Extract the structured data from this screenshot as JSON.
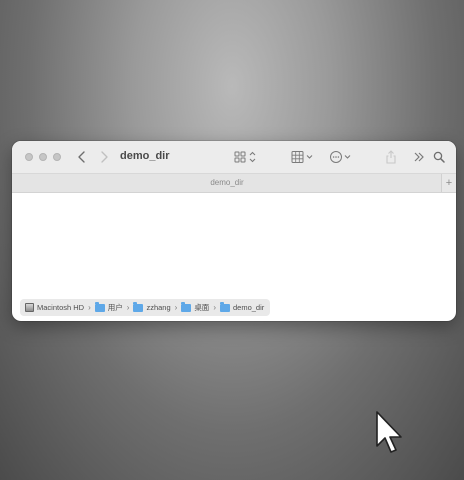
{
  "window": {
    "title": "demo_dir",
    "tab_label": "demo_dir",
    "tab_add_label": "+"
  },
  "toolbar": {
    "icons": [
      "back-icon",
      "forward-icon",
      "view-mode-icon",
      "group-icon",
      "more-actions-icon",
      "share-icon",
      "expand-toolbar-icon",
      "search-icon"
    ]
  },
  "pathbar": {
    "items": [
      {
        "label": "Macintosh HD",
        "icon": "disk-icon"
      },
      {
        "label": "用户",
        "icon": "folder-icon"
      },
      {
        "label": "zzhang",
        "icon": "folder-icon"
      },
      {
        "label": "桌面",
        "icon": "folder-icon"
      },
      {
        "label": "demo_dir",
        "icon": "folder-icon"
      }
    ],
    "separator": "›"
  },
  "colors": {
    "desktop_center": "#b9b9b9",
    "desktop_edge": "#4b4b4b",
    "toolbar_bg": "#ececec",
    "folder_blue": "#5ea8e8"
  }
}
